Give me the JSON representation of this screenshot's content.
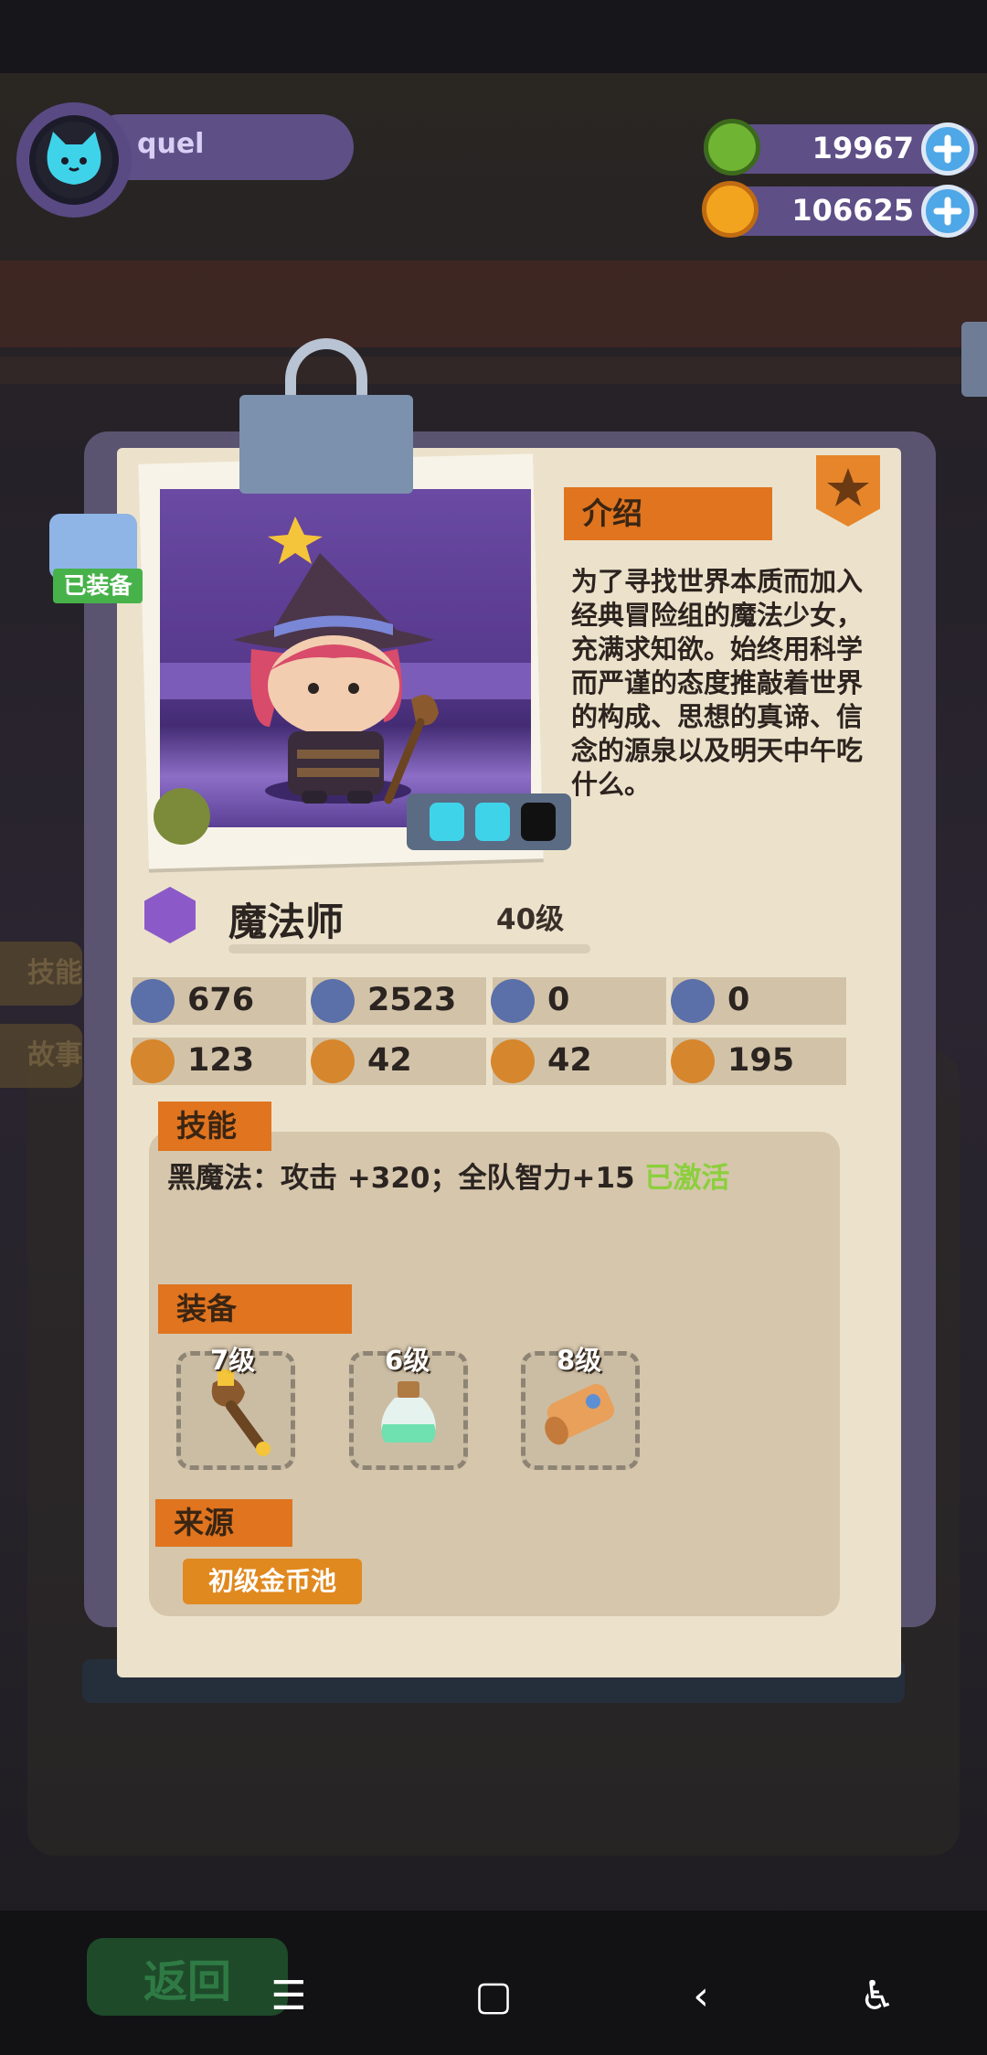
{
  "player": {
    "name": "quel"
  },
  "currency": {
    "gems": "19967",
    "coins": "106625"
  },
  "card": {
    "equipped_label": "已装备",
    "intro_title": "介绍",
    "description": "为了寻找世界本质而加入经典冒险组的魔法少女，充满求知欲。始终用科学而严谨的态度推敲着世界的构成、思想的真谛、信念的源泉以及明天中午吃什么。",
    "class_name": "魔法师",
    "level": "40级",
    "stats": [
      {
        "icon": "shield-heart-icon",
        "value": "676"
      },
      {
        "icon": "shield-sword-icon",
        "value": "2523"
      },
      {
        "icon": "shield-icon",
        "value": "0"
      },
      {
        "icon": "shield-anchor-icon",
        "value": "0"
      },
      {
        "icon": "strength-icon",
        "value": "123"
      },
      {
        "icon": "face-icon",
        "value": "42"
      },
      {
        "icon": "muscle-icon",
        "value": "42"
      },
      {
        "icon": "brain-icon",
        "value": "195"
      }
    ],
    "skills_title": "技能",
    "skill_text": "黑魔法：攻击 +320；全队智力+15 ",
    "skill_status": "已激活",
    "equipment_title": "装备",
    "equipment": [
      {
        "icon": "staff-icon",
        "level": "7级"
      },
      {
        "icon": "potion-icon",
        "level": "6级"
      },
      {
        "icon": "scroll-icon",
        "level": "8级"
      }
    ],
    "source_title": "来源",
    "source_value": "初级金币池"
  },
  "background": {
    "return_button": "返回",
    "tabs": [
      "技能",
      "故事"
    ]
  },
  "colors": {
    "accent_orange": "#e0741f",
    "panel_purple": "#5e4f86",
    "active_green": "#8ccf3c"
  }
}
